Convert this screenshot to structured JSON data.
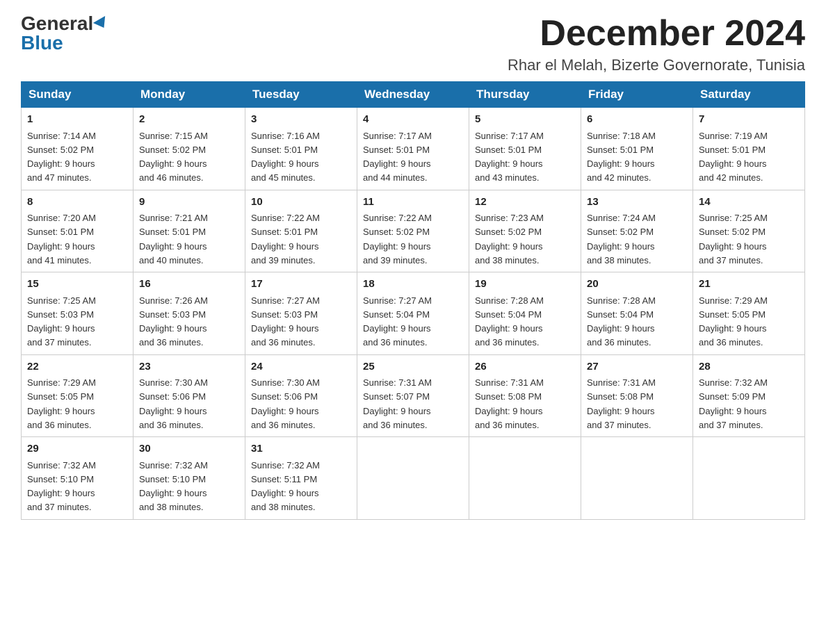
{
  "logo": {
    "general": "General",
    "blue": "Blue"
  },
  "title": "December 2024",
  "location": "Rhar el Melah, Bizerte Governorate, Tunisia",
  "days_of_week": [
    "Sunday",
    "Monday",
    "Tuesday",
    "Wednesday",
    "Thursday",
    "Friday",
    "Saturday"
  ],
  "weeks": [
    [
      {
        "day": "1",
        "sunrise": "7:14 AM",
        "sunset": "5:02 PM",
        "daylight": "9 hours and 47 minutes."
      },
      {
        "day": "2",
        "sunrise": "7:15 AM",
        "sunset": "5:02 PM",
        "daylight": "9 hours and 46 minutes."
      },
      {
        "day": "3",
        "sunrise": "7:16 AM",
        "sunset": "5:01 PM",
        "daylight": "9 hours and 45 minutes."
      },
      {
        "day": "4",
        "sunrise": "7:17 AM",
        "sunset": "5:01 PM",
        "daylight": "9 hours and 44 minutes."
      },
      {
        "day": "5",
        "sunrise": "7:17 AM",
        "sunset": "5:01 PM",
        "daylight": "9 hours and 43 minutes."
      },
      {
        "day": "6",
        "sunrise": "7:18 AM",
        "sunset": "5:01 PM",
        "daylight": "9 hours and 42 minutes."
      },
      {
        "day": "7",
        "sunrise": "7:19 AM",
        "sunset": "5:01 PM",
        "daylight": "9 hours and 42 minutes."
      }
    ],
    [
      {
        "day": "8",
        "sunrise": "7:20 AM",
        "sunset": "5:01 PM",
        "daylight": "9 hours and 41 minutes."
      },
      {
        "day": "9",
        "sunrise": "7:21 AM",
        "sunset": "5:01 PM",
        "daylight": "9 hours and 40 minutes."
      },
      {
        "day": "10",
        "sunrise": "7:22 AM",
        "sunset": "5:01 PM",
        "daylight": "9 hours and 39 minutes."
      },
      {
        "day": "11",
        "sunrise": "7:22 AM",
        "sunset": "5:02 PM",
        "daylight": "9 hours and 39 minutes."
      },
      {
        "day": "12",
        "sunrise": "7:23 AM",
        "sunset": "5:02 PM",
        "daylight": "9 hours and 38 minutes."
      },
      {
        "day": "13",
        "sunrise": "7:24 AM",
        "sunset": "5:02 PM",
        "daylight": "9 hours and 38 minutes."
      },
      {
        "day": "14",
        "sunrise": "7:25 AM",
        "sunset": "5:02 PM",
        "daylight": "9 hours and 37 minutes."
      }
    ],
    [
      {
        "day": "15",
        "sunrise": "7:25 AM",
        "sunset": "5:03 PM",
        "daylight": "9 hours and 37 minutes."
      },
      {
        "day": "16",
        "sunrise": "7:26 AM",
        "sunset": "5:03 PM",
        "daylight": "9 hours and 36 minutes."
      },
      {
        "day": "17",
        "sunrise": "7:27 AM",
        "sunset": "5:03 PM",
        "daylight": "9 hours and 36 minutes."
      },
      {
        "day": "18",
        "sunrise": "7:27 AM",
        "sunset": "5:04 PM",
        "daylight": "9 hours and 36 minutes."
      },
      {
        "day": "19",
        "sunrise": "7:28 AM",
        "sunset": "5:04 PM",
        "daylight": "9 hours and 36 minutes."
      },
      {
        "day": "20",
        "sunrise": "7:28 AM",
        "sunset": "5:04 PM",
        "daylight": "9 hours and 36 minutes."
      },
      {
        "day": "21",
        "sunrise": "7:29 AM",
        "sunset": "5:05 PM",
        "daylight": "9 hours and 36 minutes."
      }
    ],
    [
      {
        "day": "22",
        "sunrise": "7:29 AM",
        "sunset": "5:05 PM",
        "daylight": "9 hours and 36 minutes."
      },
      {
        "day": "23",
        "sunrise": "7:30 AM",
        "sunset": "5:06 PM",
        "daylight": "9 hours and 36 minutes."
      },
      {
        "day": "24",
        "sunrise": "7:30 AM",
        "sunset": "5:06 PM",
        "daylight": "9 hours and 36 minutes."
      },
      {
        "day": "25",
        "sunrise": "7:31 AM",
        "sunset": "5:07 PM",
        "daylight": "9 hours and 36 minutes."
      },
      {
        "day": "26",
        "sunrise": "7:31 AM",
        "sunset": "5:08 PM",
        "daylight": "9 hours and 36 minutes."
      },
      {
        "day": "27",
        "sunrise": "7:31 AM",
        "sunset": "5:08 PM",
        "daylight": "9 hours and 37 minutes."
      },
      {
        "day": "28",
        "sunrise": "7:32 AM",
        "sunset": "5:09 PM",
        "daylight": "9 hours and 37 minutes."
      }
    ],
    [
      {
        "day": "29",
        "sunrise": "7:32 AM",
        "sunset": "5:10 PM",
        "daylight": "9 hours and 37 minutes."
      },
      {
        "day": "30",
        "sunrise": "7:32 AM",
        "sunset": "5:10 PM",
        "daylight": "9 hours and 38 minutes."
      },
      {
        "day": "31",
        "sunrise": "7:32 AM",
        "sunset": "5:11 PM",
        "daylight": "9 hours and 38 minutes."
      },
      null,
      null,
      null,
      null
    ]
  ],
  "labels": {
    "sunrise": "Sunrise:",
    "sunset": "Sunset:",
    "daylight": "Daylight:"
  }
}
